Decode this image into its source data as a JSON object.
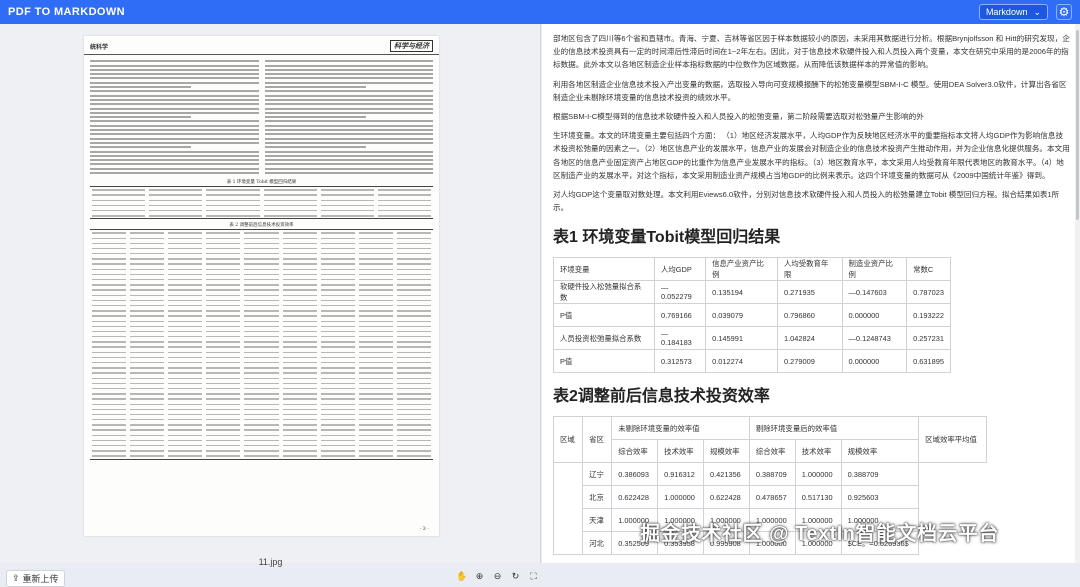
{
  "app": {
    "title": "PDF TO MARKDOWN"
  },
  "header": {
    "mode_select": "Markdown",
    "mode_caret": "⌄",
    "settings_icon": "gear-icon"
  },
  "source": {
    "filename": "11.jpg",
    "reupload_label": "重新上传",
    "reupload_icon": "upload-icon",
    "tools": [
      "hand-icon",
      "zoom-in-icon",
      "zoom-out-icon",
      "rotate-icon",
      "fullscreen-icon"
    ],
    "scan": {
      "journal": "统科学",
      "section": "科学与经济",
      "table1_caption": "表 1   环境变量 Tobit 模型回归结果",
      "table2_caption": "表 2   调整前后信息技术投资效率",
      "page": "· 3 ·"
    }
  },
  "markdown": {
    "paras": [
      "部地区包含了四川等6个省和直辖市。青海、宁夏、吉林等省区因于样本数据较小的原因，未采用其数据进行分析。根据Brynjolfsson 和 Hitt的研究发现，企业的信息技术投资具有一定的时间滞后性滞后时间在1~2年左右。因此，对于信息技术软硬件投入和人员投入两个变量，本文在研究中采用的是2006年的指标数据。此外本文以各地区制造企业样本指标数据的中位数作为区域数据，从而降低该数据样本的异常值的影响。",
      "利用各地区制造企业信息技术投入产出变量的数据，选取投入导向可变规模报酬下的松弛变量模型SBM-I-C 模型。使用DEA Solver3.0软件，计算出各省区制造企业未剔除环境变量的信息技术投资的绩效水平。",
      "根据SBM-I-C模型得到的信息技术软硬件投入和人员投入的松弛变量，第二阶段需要选取对松弛量产生影响的外",
      "生环境变量。本文的环境变量主要包括四个方面： （1）地区经济发展水平，人均GDP作为反映地区经济水平的重要指标本文将人均GDP作为影响信息技术投资松弛量的因素之一。（2）地区信息产业的发展水平，信息产业的发展会对制造企业的信息技术投资产生推动作用，并为企业信息化提供服务。本文用各地区的信息产业固定资产占地区GDP的比重作为信息产业发展水平的指标。（3）地区教育水平，本文采用人均受教育年限代表地区的教育水平。（4）地区制造产业的发展水平，对这个指标，本文采用制造业资产规模占当地GDP的比例来表示。这四个环境变量的数据可从《2009中国统计年鉴》得到。",
      "对人均GDP这个变量取对数处理。本文利用Eviews6.0软件，分别对信息技术软硬件投入和人员投入的松弛量建立Tobit 模型回归方程。拟合结果如表1所示。"
    ],
    "table1": {
      "heading": "表1 环境变量Tobit模型回归结果",
      "rows": [
        [
          "环境变量",
          "人均GDP",
          "信息产业资产比例",
          "人均受教育年限",
          "制造业资产比例",
          "常数C"
        ],
        [
          "软硬件投入松弛量拟合系数",
          "—0.052279",
          "0.135194",
          "0.271935",
          "—0.147603",
          "0.787023"
        ],
        [
          "P值",
          "0.769166",
          "0.039079",
          "0.796860",
          "0.000000",
          "0.193222"
        ],
        [
          "人员投资松弛量拟合系数",
          "—0.184183",
          "0.145991",
          "1.042824",
          "—0.1248743",
          "0.257231"
        ],
        [
          "P值",
          "0.312573",
          "0.012274",
          "0.279009",
          "0.000000",
          "0.631895"
        ]
      ]
    },
    "table2": {
      "heading": "表2调整前后信息技术投资效率",
      "col_region": "区域",
      "col_province": "省区",
      "group_before": "未剔除环境变量的效率值",
      "group_after": "剔除环境变量后的效率值",
      "col_avg": "区域效率平均值",
      "sub": [
        "综合效率",
        "技术效率",
        "规模效率",
        "综合效率",
        "技术效率",
        "规模效率"
      ],
      "rows": [
        [
          "辽宁",
          "0.386093",
          "0.916312",
          "0.421356",
          "0.388709",
          "1.000000",
          "0.388709"
        ],
        [
          "北京",
          "0.622428",
          "1.000000",
          "0.622428",
          "0.478657",
          "0.517130",
          "0.925603"
        ],
        [
          "天津",
          "1.000000",
          "1.000000",
          "1.000000",
          "1.000000",
          "1.000000",
          "1.000000"
        ],
        [
          "河北",
          "0.352509",
          "0.353958",
          "0.995908",
          "1.000000",
          "1.000000",
          "$CE。=0.626936$"
        ]
      ]
    }
  },
  "watermark": "掘金技术社区 @ TextIn智能文档云平台"
}
